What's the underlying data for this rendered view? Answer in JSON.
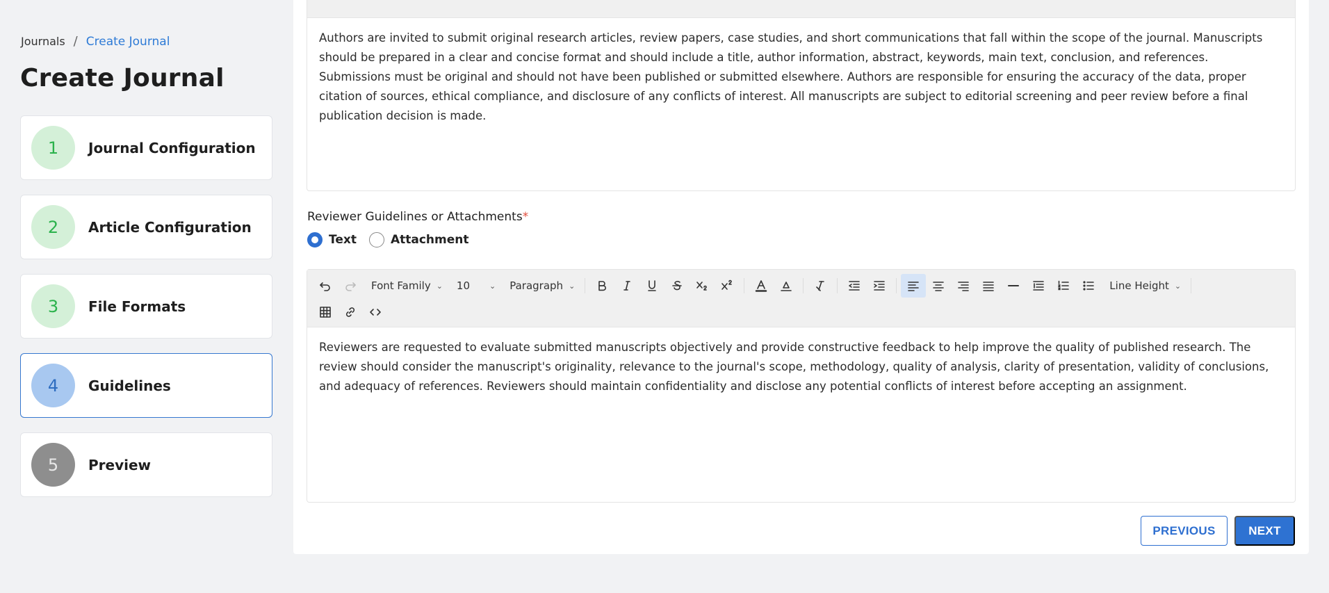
{
  "breadcrumb": {
    "root": "Journals",
    "separator": "/",
    "current": "Create Journal"
  },
  "page_title": "Create Journal",
  "steps": [
    {
      "number": "1",
      "label": "Journal Configuration",
      "state": "done"
    },
    {
      "number": "2",
      "label": "Article Configuration",
      "state": "done"
    },
    {
      "number": "3",
      "label": "File Formats",
      "state": "done"
    },
    {
      "number": "4",
      "label": "Guidelines",
      "state": "active"
    },
    {
      "number": "5",
      "label": "Preview",
      "state": "pending"
    }
  ],
  "author_guidelines": {
    "text": "Authors are invited to submit original research articles, review papers, case studies, and short communications that fall within the scope of the journal. Manuscripts should be prepared in a clear and concise format and should include a title, author information, abstract, keywords, main text, conclusion, and references. Submissions must be original and should not have been published or submitted elsewhere. Authors are responsible for ensuring the accuracy of the data, proper citation of sources, ethical compliance, and disclosure of any conflicts of interest. All manuscripts are subject to editorial screening and peer review before a final publication decision is made."
  },
  "reviewer_guidelines": {
    "label": "Reviewer Guidelines or Attachments",
    "required_mark": "*",
    "options": [
      {
        "label": "Text",
        "checked": true
      },
      {
        "label": "Attachment",
        "checked": false
      }
    ],
    "text": "Reviewers are requested to evaluate submitted manuscripts objectively and provide constructive feedback to help improve the quality of published research. The review should consider the manuscript's originality, relevance to the journal's scope, methodology, quality of analysis, clarity of presentation, validity of conclusions, and adequacy of references. Reviewers should maintain confidentiality and disclose any potential conflicts of interest before accepting an assignment."
  },
  "toolbar": {
    "font_family": "Font Family",
    "font_size": "10",
    "block_format": "Paragraph",
    "line_height": "Line Height"
  },
  "buttons": {
    "previous": "PREVIOUS",
    "next": "NEXT"
  },
  "colors": {
    "accent": "#2e72d2",
    "done_step_bg": "#d4f0d8",
    "done_step_text": "#2bb24c",
    "active_step_bg": "#a8c8f0",
    "pending_step_bg": "#8e8e8e"
  }
}
